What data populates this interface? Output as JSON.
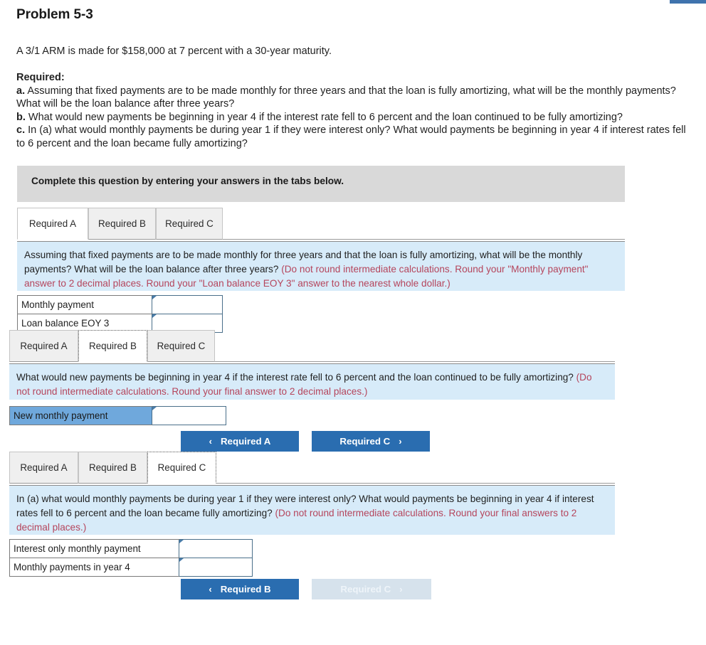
{
  "title": "Problem 5-3",
  "intro": "A 3/1 ARM is made for $158,000 at 7 percent with a 30-year maturity.",
  "required": {
    "heading": "Required:",
    "items": [
      {
        "letter": "a.",
        "text": "Assuming that fixed payments are to be made monthly for three years and that the loan is fully amortizing, what will be the monthly payments? What will be the loan balance after three years?"
      },
      {
        "letter": "b.",
        "text": "What would new payments be beginning in year 4 if the interest rate fell to 6 percent and the loan continued to be fully amortizing?"
      },
      {
        "letter": "c.",
        "text": "In (a) what would monthly payments be during year 1 if they were interest only? What would payments be beginning in year 4 if interest rates fell to 6 percent and the loan became fully amortizing?"
      }
    ]
  },
  "instruction_band": "Complete this question by entering your answers in the tabs below.",
  "tabs": {
    "labels": [
      "Required A",
      "Required B",
      "Required C"
    ]
  },
  "sections": [
    {
      "active_tab": "Required A",
      "prompt": "Assuming that fixed payments are to be made monthly for three years and that the loan is fully amortizing, what will be the monthly payments? What will be the loan balance after three years? ",
      "hint": "(Do not round intermediate calculations. Round your \"Monthly payment\" answer to 2 decimal places. Round your \"Loan balance EOY 3\" answer to the nearest whole dollar.)",
      "rows": [
        {
          "label": "Monthly payment",
          "value": "",
          "selected": false
        },
        {
          "label": "Loan balance EOY 3",
          "value": "",
          "selected": false
        }
      ],
      "buttons": []
    },
    {
      "active_tab": "Required B",
      "prompt": "What would new payments be beginning in year 4 if the interest rate fell to 6 percent and the loan continued to be fully amortizing? ",
      "hint": "(Do not round intermediate calculations. Round your final answer to 2 decimal places.)",
      "rows": [
        {
          "label": "New monthly payment",
          "value": "",
          "selected": true
        }
      ],
      "buttons": [
        {
          "label": "Required A",
          "direction": "prev",
          "chev": "‹",
          "disabled": false
        },
        {
          "label": "Required C",
          "direction": "next",
          "chev": "›",
          "disabled": false
        }
      ]
    },
    {
      "active_tab": "Required C",
      "prompt": "In (a) what would monthly payments be during year 1 if they were interest only? What would payments be beginning in year 4 if interest rates fell to 6 percent and the loan became fully amortizing? ",
      "hint": "(Do not round intermediate calculations. Round your final answers to 2 decimal places.)",
      "rows": [
        {
          "label": "Interest only monthly payment",
          "value": "",
          "selected": false
        },
        {
          "label": "Monthly payments in year 4",
          "value": "",
          "selected": false
        }
      ],
      "buttons": [
        {
          "label": "Required B",
          "direction": "prev",
          "chev": "‹",
          "disabled": false
        },
        {
          "label": "Required C",
          "direction": "next",
          "chev": "›",
          "disabled": true
        }
      ]
    }
  ],
  "colors": {
    "accent_blue": "#2a6db0",
    "info_panel": "#d7ebf9",
    "hint_red": "#b5455c",
    "band_gray": "#d9d9d9",
    "selected_row": "#6fa8dc"
  }
}
